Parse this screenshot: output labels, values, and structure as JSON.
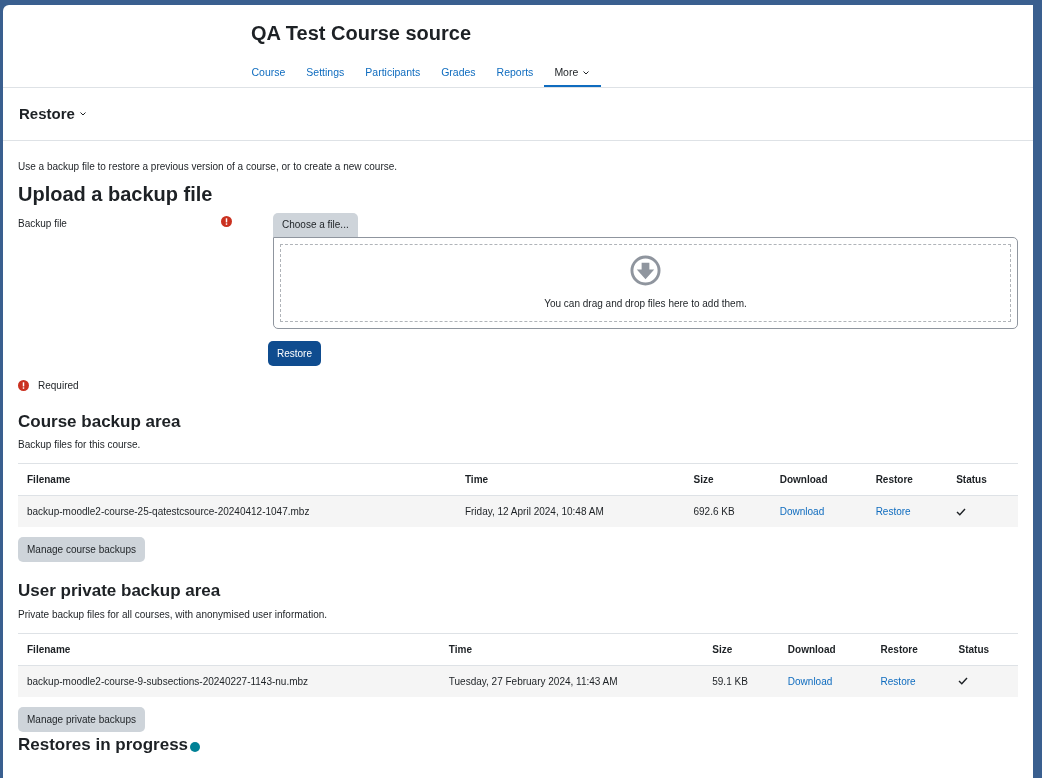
{
  "course_title": "QA Test Course source",
  "nav_tabs": [
    {
      "label": "Course",
      "selected": false
    },
    {
      "label": "Settings",
      "selected": false
    },
    {
      "label": "Participants",
      "selected": false
    },
    {
      "label": "Grades",
      "selected": false
    },
    {
      "label": "Reports",
      "selected": false
    },
    {
      "label": "More",
      "selected": true,
      "kind": "dropdown"
    }
  ],
  "page_menu": {
    "label": "Restore"
  },
  "intro": "Use a backup file to restore a previous version of a course, or to create a new course.",
  "upload": {
    "heading": "Upload a backup file",
    "field_label": "Backup file",
    "required": true,
    "choose_button": "Choose a file...",
    "dropzone_text": "You can drag and drop files here to add them.",
    "submit_button": "Restore",
    "required_note": "Required"
  },
  "areas": [
    {
      "heading": "Course backup area",
      "description": "Backup files for this course.",
      "columns": [
        "Filename",
        "Time",
        "Size",
        "Download",
        "Restore",
        "Status"
      ],
      "rows": [
        {
          "filename": "backup-moodle2-course-25-qatestcsource-20240412-1047.mbz",
          "time": "Friday, 12 April 2024, 10:48 AM",
          "size": "692.6 KB",
          "download": "Download",
          "restore": "Restore",
          "done": true
        }
      ],
      "manage_button": "Manage course backups"
    },
    {
      "heading": "User private backup area",
      "description": "Private backup files for all courses, with anonymised user information.",
      "columns": [
        "Filename",
        "Time",
        "Size",
        "Download",
        "Restore",
        "Status"
      ],
      "rows": [
        {
          "filename": "backup-moodle2-course-9-subsections-20240227-1143-nu.mbz",
          "time": "Tuesday, 27 February 2024, 11:43 AM",
          "size": "59.1 KB",
          "download": "Download",
          "restore": "Restore",
          "done": true
        }
      ],
      "manage_button": "Manage private backups"
    }
  ],
  "in_progress": {
    "heading": "Restores in progress",
    "help": true
  }
}
